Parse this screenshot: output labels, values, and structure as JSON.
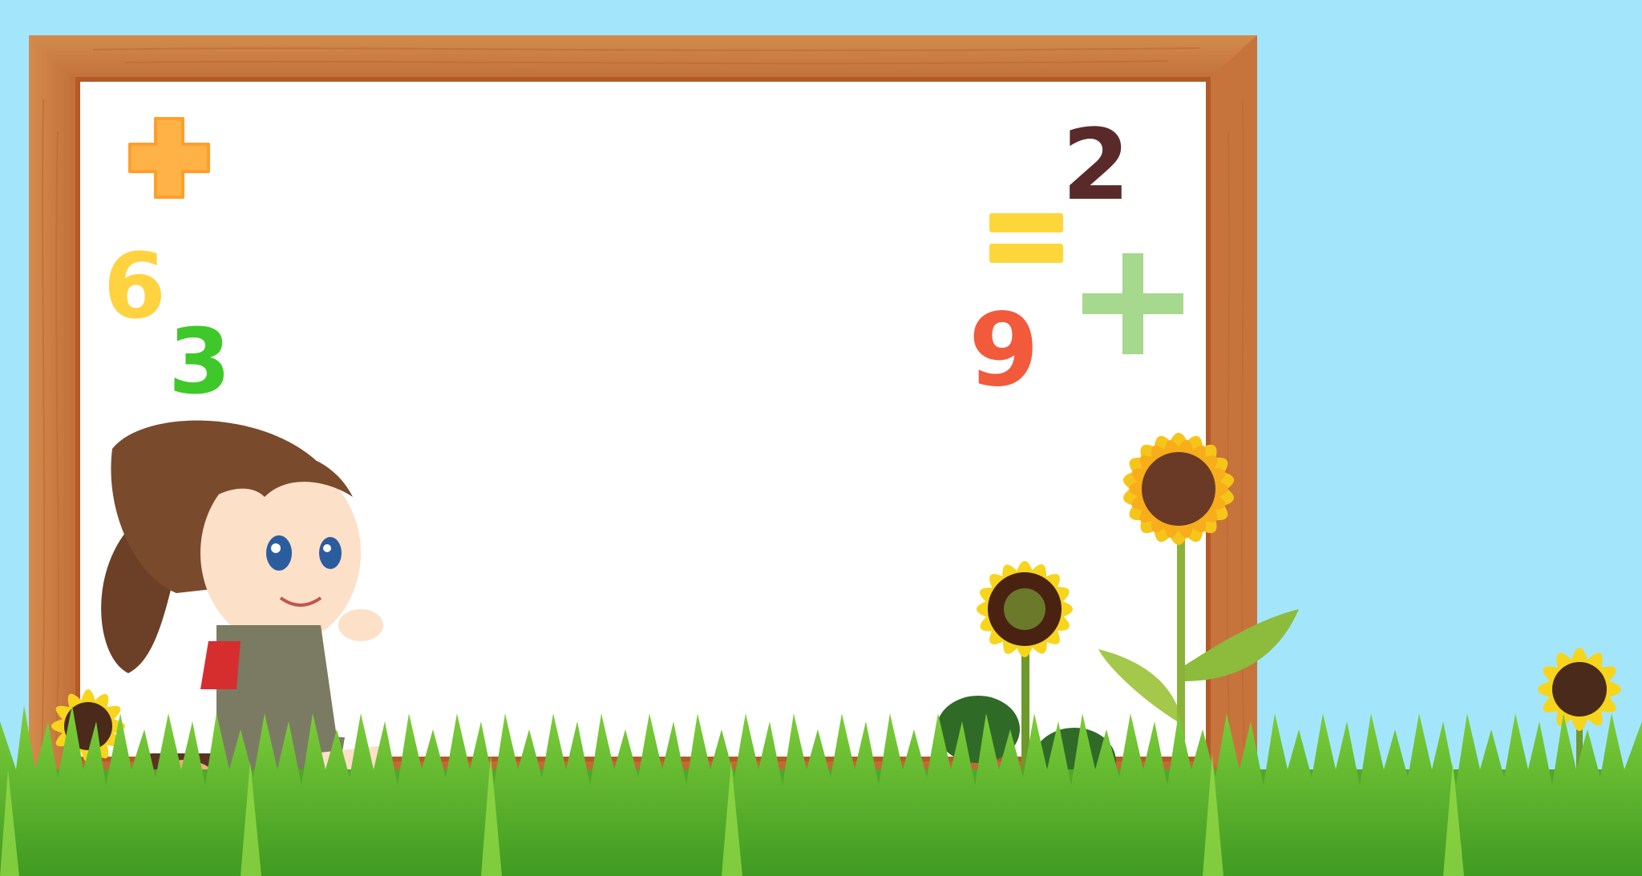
{
  "scene": {
    "background_color": "#a3e6fb",
    "board": {
      "frame_color": "#cf8448",
      "frame_dark": "#b45a28",
      "surface_color": "#ffffff"
    },
    "math_symbols": [
      {
        "name": "plus-orange",
        "text": "+",
        "color": "#ffb347"
      },
      {
        "name": "digit-6",
        "text": "6",
        "color": "#ffd23f"
      },
      {
        "name": "digit-3",
        "text": "3",
        "color": "#3fc82a"
      },
      {
        "name": "digit-2",
        "text": "2",
        "color": "#5a2a2a"
      },
      {
        "name": "equals-yellow",
        "text": "=",
        "color": "#fdd63a"
      },
      {
        "name": "digit-9",
        "text": "9",
        "color": "#f25a3c"
      },
      {
        "name": "plus-green",
        "text": "+",
        "color": "#a6d88e"
      }
    ],
    "decorations": [
      "girl-sitting-on-log",
      "sunflower-large",
      "sunflower-medium",
      "sunflower-small-left",
      "sunflower-small-right",
      "grass"
    ]
  }
}
